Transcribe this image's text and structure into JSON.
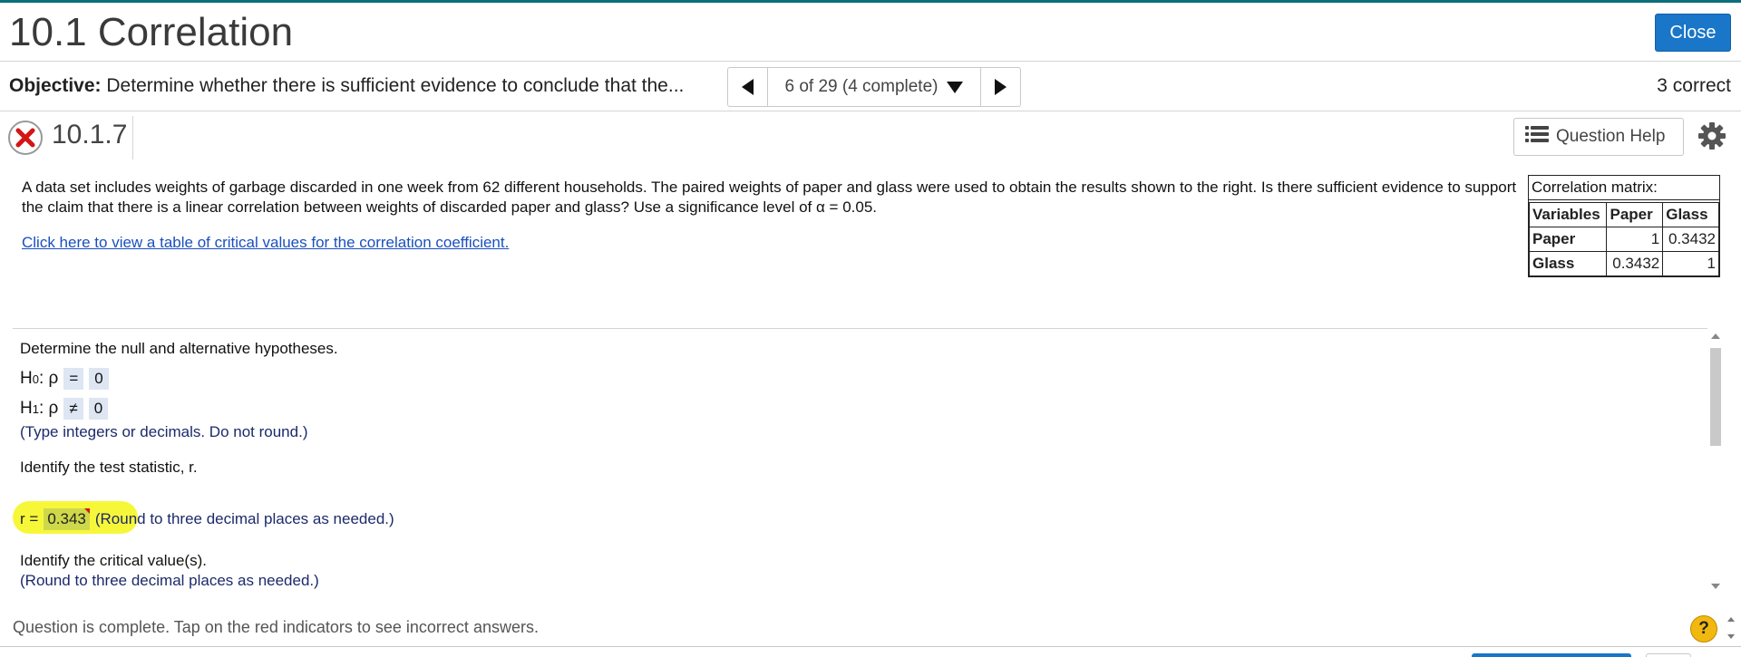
{
  "header": {
    "title": "10.1 Correlation",
    "close_label": "Close"
  },
  "objective": {
    "label": "Objective:",
    "text": "Determine whether there is sufficient evidence to conclude that the...",
    "progress": "6 of 29 (4 complete)",
    "score": "3 correct"
  },
  "question": {
    "number": "10.1.7",
    "help_label": "Question Help"
  },
  "problem": {
    "text": "A data set includes weights of garbage discarded in one week from 62 different households. The paired weights of paper and glass were used to obtain the results shown to the right. Is there sufficient evidence to support the claim that there is a linear correlation between weights of discarded paper and glass? Use a significance level of α = 0.05.",
    "link": "Click here to view a table of critical values for the correlation coefficient."
  },
  "matrix": {
    "caption": "Correlation matrix:",
    "headers": [
      "Variables",
      "Paper",
      "Glass"
    ],
    "rows": [
      {
        "label": "Paper",
        "paper": "1",
        "glass": "0.3432"
      },
      {
        "label": "Glass",
        "paper": "0.3432",
        "glass": "1"
      }
    ]
  },
  "answer": {
    "prompt_hyp": "Determine the null and alternative hypotheses.",
    "h0": {
      "H": "H",
      "sub": "0",
      "param": ": ρ",
      "op": "=",
      "value": "0"
    },
    "h1": {
      "H": "H",
      "sub": "1",
      "param": ": ρ",
      "op": "≠",
      "value": "0"
    },
    "hyp_note": "(Type integers or decimals. Do not round.)",
    "prompt_stat": "Identify the test statistic, r.",
    "r_label": "r =",
    "r_value": "0.343",
    "r_note": "(Round to three decimal places as needed.)",
    "prompt_crit": "Identify the critical value(s).",
    "crit_note": "(Round to three decimal places as needed.)"
  },
  "footer": {
    "message": "Question is complete. Tap on the red indicators to see incorrect answers.",
    "help_symbol": "?"
  },
  "colors": {
    "primary": "#1976c8",
    "highlight": "#f7f73a",
    "incorrect": "#d41515",
    "link": "#1a4fbf"
  },
  "icons": [
    "incorrect-x-icon",
    "list-icon",
    "gear-icon",
    "help-icon"
  ]
}
